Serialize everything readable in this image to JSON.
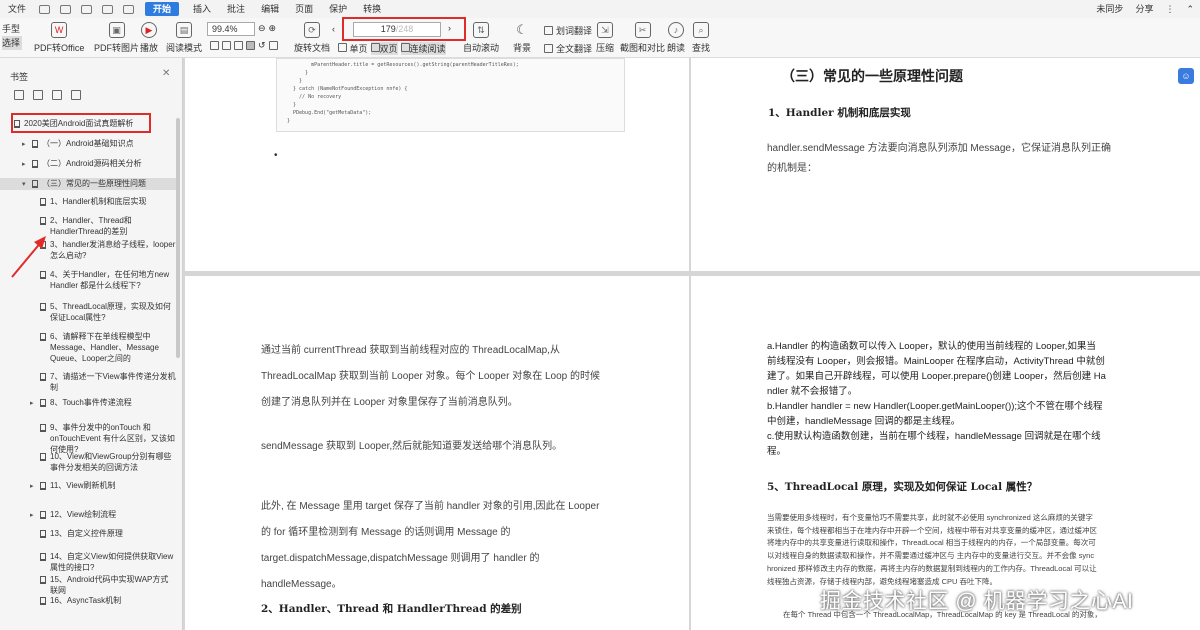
{
  "menubar": {
    "file": "文件",
    "start": "开始",
    "tabs": [
      "插入",
      "批注",
      "编辑",
      "页面",
      "保护",
      "转换"
    ],
    "right": [
      "未同步",
      "分享"
    ]
  },
  "toolbar": {
    "hand": "手型",
    "select": "选择",
    "pdf_to_office": "PDF转Office",
    "pdf_to_image": "PDF转图片",
    "play": "播放",
    "read_mode": "阅读模式",
    "zoom": "99.4%",
    "rotate": "旋转文档",
    "single": "单页",
    "double": "双页",
    "continuous": "连续阅读",
    "auto_scroll": "自动滚动",
    "background": "背景",
    "word_translate": "划词翻译",
    "full_translate": "全文翻译",
    "compress": "压缩",
    "screenshot": "截图和对比",
    "read_aloud": "朗读",
    "find": "查找",
    "page_current": "179",
    "page_total": "/248"
  },
  "sidebar": {
    "title": "书签",
    "items": [
      {
        "label": "2020美团Android面试真题解析",
        "level": 0,
        "tri": ""
      },
      {
        "label": "（一）Android基础知识点",
        "level": 1,
        "tri": "▸"
      },
      {
        "label": "（二）Android源码相关分析",
        "level": 1,
        "tri": "▸"
      },
      {
        "label": "（三）常见的一些原理性问题",
        "level": 1,
        "tri": "◂"
      },
      {
        "label": "1、Handler机制和底层实现",
        "level": 2,
        "tri": ""
      },
      {
        "label": "2、Handler、Thread和HandlerThread的差别",
        "level": 2,
        "tri": ""
      },
      {
        "label": "3、handler发消息给子线程，looper怎么启动?",
        "level": 2,
        "tri": ""
      },
      {
        "label": "4、关于Handler，在任何地方new Handler 都是什么线程下?",
        "level": 2,
        "tri": ""
      },
      {
        "label": "5、ThreadLocal原理，实现及如何保证Local属性?",
        "level": 2,
        "tri": ""
      },
      {
        "label": "6、请解释下在单线程模型中Message、Handler、Message Queue、Looper之间的",
        "level": 2,
        "tri": ""
      },
      {
        "label": "7、请描述一下View事件传递分发机制",
        "level": 2,
        "tri": ""
      },
      {
        "label": "8、Touch事件传递流程",
        "level": 2,
        "tri": "▸"
      },
      {
        "label": "9、事件分发中的onTouch 和onTouchEvent 有什么区别，又该如何使用?",
        "level": 2,
        "tri": ""
      },
      {
        "label": "10、View和ViewGroup分别有哪些事件分发相关的回调方法",
        "level": 2,
        "tri": ""
      },
      {
        "label": "11、View刷新机制",
        "level": 2,
        "tri": "▸"
      },
      {
        "label": "12、View绘制流程",
        "level": 2,
        "tri": "▸"
      },
      {
        "label": "13、自定义控件原理",
        "level": 2,
        "tri": ""
      },
      {
        "label": "14、自定义View如何提供获取View属性的接口?",
        "level": 2,
        "tri": ""
      },
      {
        "label": "15、Android代码中实现WAP方式联网",
        "level": 2,
        "tri": ""
      },
      {
        "label": "16、AsyncTask机制",
        "level": 2,
        "tri": ""
      }
    ]
  },
  "doc": {
    "code_lines": [
      "        mParentHeader.title = getResources().getString(parentHeaderTitleRes);",
      "      }",
      "    }",
      "  } catch (NameNotFoundException nnfe) {",
      "    // No recovery",
      "  }",
      "  PDebug.End(\"getMetaData\");",
      "}"
    ],
    "bullet": "•",
    "section_title": "（三）常见的一些原理性问题",
    "sub1": "1、Handler 机制和底层实现",
    "tr_para": [
      "handler.sendMessage 方法要向消息队列添加 Message，它保证消息队列正确",
      "的机制是："
    ],
    "bl_para1": [
      "通过当前 currentThread 获取到当前线程对应的 ThreadLocalMap,从",
      "ThreadLocalMap 获取到当前 Looper 对象。每个 Looper 对象在 Loop 的时候",
      "创建了消息队列并在 Looper 对象里保存了当前消息队列。"
    ],
    "bl_para2": "sendMessage 获取到 Looper,然后就能知道要发送给哪个消息队列。",
    "bl_para3": [
      "此外, 在 Message 里用  target 保存了当前 handler 对象的引用,因此在 Looper",
      "的 for 循环里检测到有 Message 的话则调用 Message 的",
      "target.dispatchMessage,dispatchMessage 则调用了 handler 的",
      "handleMessage。"
    ],
    "bl_sub2": "2、Handler、Thread 和 HandlerThread 的差别",
    "br_para1": [
      "a.Handler 的构造函数可以传入 Looper，默认的使用当前线程的 Looper,如果当",
      "前线程没有 Looper，则会报错。MainLooper 在程序启动，ActivityThread 中就创",
      "建了。如果自己开辟线程，可以使用 Looper.prepare()创建 Looper，然后创建 Ha",
      "ndler 就不会报错了。",
      "b.Handler handler = new Handler(Looper.getMainLooper());这个不管在哪个线程",
      "中创建，handleMessage 回调的都是主线程。",
      "c.使用默认构造函数创建，当前在哪个线程，handleMessage 回调就是在哪个线",
      "程。"
    ],
    "br_sub5": "5、ThreadLocal 原理，实现及如何保证 Local 属性？",
    "br_para2": [
      "当需要使用多线程时，有个变量恰巧不需要共享，此时就不必使用 synchronized 这么麻烦的关键字",
      "来锁住，每个线程都相当于在堆内存中开辟一个空间，线程中带有对共享变量的缓冲区，通过缓冲区",
      "将堆内存中的共享变量进行读取和操作，ThreadLocal 相当于线程内的内存，一个局部变量。每次可",
      "以对线程自身的数据读取和操作，并不需要通过缓冲区与 主内存中的变量进行交互。并不会像 sync",
      "hronized 那样修改主内存的数据，再将主内存的数据复制到线程内的工作内存。ThreadLocal 可以让",
      "线程独占资源，存储于线程内部，避免线程堵塞造成 CPU 吞吐下降。"
    ],
    "br_para3": "在每个 Thread 中包含一个 ThreadLocalMap，ThreadLocalMap 的 key 是 ThreadLocal 的对象，"
  },
  "watermark": "掘金技术社区 @ 机器学习之心AI",
  "colors": {
    "accent": "#2f7ce0",
    "annotation_red": "#e02b2b"
  }
}
